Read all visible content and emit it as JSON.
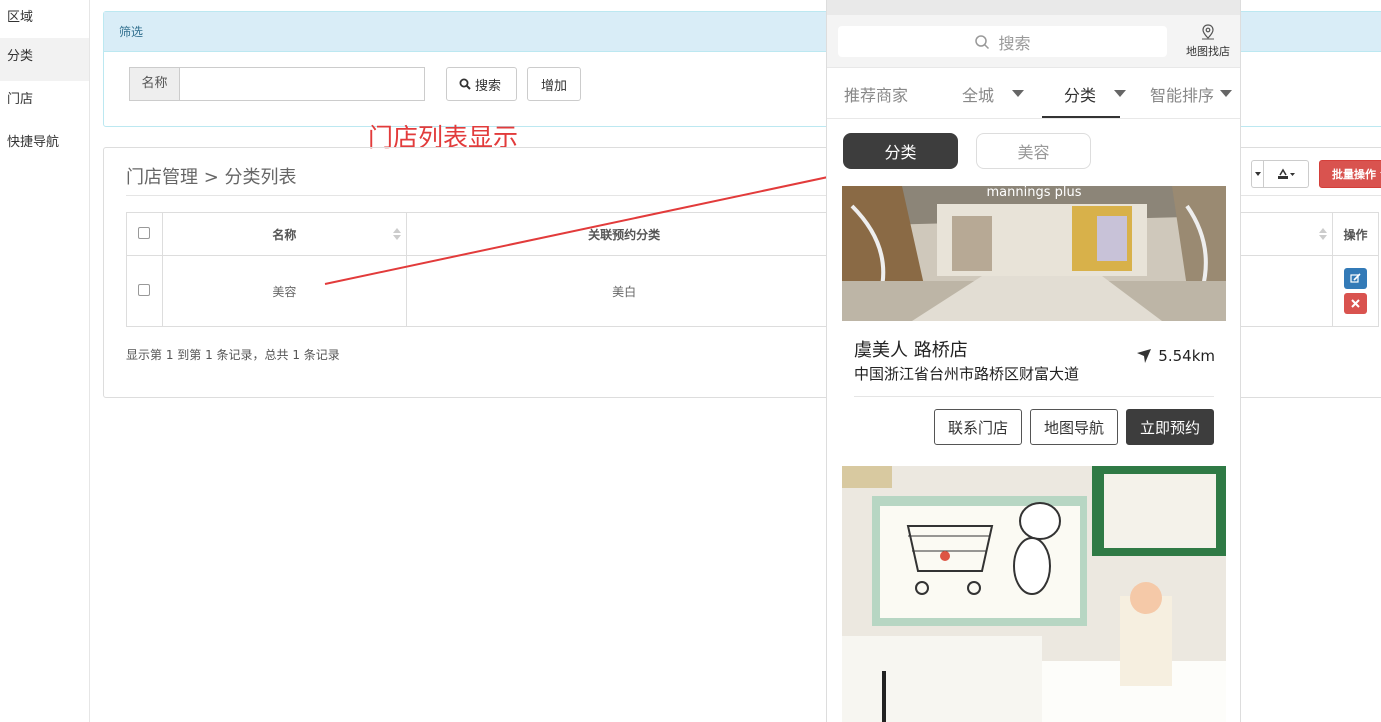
{
  "sidebar": {
    "items": [
      {
        "label": "区域"
      },
      {
        "label": "分类"
      },
      {
        "label": "门店"
      },
      {
        "label": "快捷导航"
      }
    ]
  },
  "filter_panel": {
    "heading": "筛选",
    "name_label": "名称",
    "name_value": "",
    "search_button": "搜索",
    "add_button": "增加"
  },
  "annotation": "门店列表显示",
  "list_panel": {
    "breadcrumb": "门店管理 > 分类列表",
    "batch_button": "批量操作",
    "columns": [
      "名称",
      "关联预约分类",
      "操作"
    ],
    "rows": [
      {
        "name": "美容",
        "related": "美白"
      }
    ],
    "pager": "显示第 1 到第 1 条记录，总共 1 条记录"
  },
  "phone": {
    "search_placeholder": "搜索",
    "map_find": "地图找店",
    "tabs": [
      "推荐商家",
      "全城",
      "分类",
      "智能排序"
    ],
    "chips": [
      "分类",
      "美容"
    ],
    "card": {
      "name": "虞美人 路桥店",
      "address": "中国浙江省台州市路桥区财富大道",
      "distance": "5.54km",
      "buttons": [
        "联系门店",
        "地图导航",
        "立即预约"
      ]
    }
  },
  "colors": {
    "annotation": "#e23b3b",
    "filter_heading_bg": "#d9edf7",
    "batch_button": "#d9534f",
    "edit_button": "#337ab7",
    "dark_chip": "#3d3d3d"
  }
}
